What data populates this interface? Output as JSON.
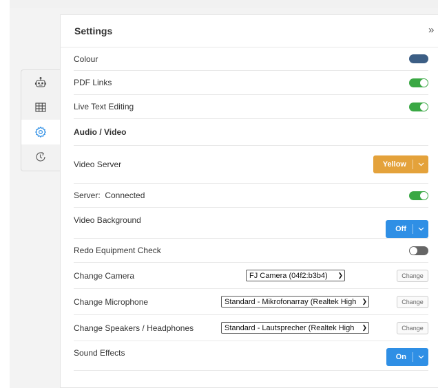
{
  "panel": {
    "title": "Settings",
    "collapse_label": "»"
  },
  "rail": {
    "items": [
      {
        "icon": "robot-icon",
        "active": false
      },
      {
        "icon": "grid-icon",
        "active": false
      },
      {
        "icon": "gear-icon",
        "active": true
      },
      {
        "icon": "history-icon",
        "active": false
      }
    ]
  },
  "rows": {
    "colour": {
      "label": "Colour",
      "toggle_on": true
    },
    "pdf_links": {
      "label": "PDF Links",
      "toggle_on": true
    },
    "live_text_editing": {
      "label": "Live Text Editing",
      "toggle_on": true
    },
    "audio_video": {
      "label": "Audio / Video"
    },
    "video_server": {
      "label": "Video Server",
      "value": "Yellow"
    },
    "server": {
      "label": "Server:  Connected",
      "toggle_on": true
    },
    "video_background": {
      "label": "Video Background",
      "value": "Off"
    },
    "redo_equipment_check": {
      "label": "Redo Equipment Check",
      "toggle_on": false
    },
    "change_camera": {
      "label": "Change Camera",
      "selected": "FJ Camera (04f2:b3b4)",
      "button": "Change"
    },
    "change_microphone": {
      "label": "Change Microphone",
      "selected": "Standard - Mikrofonarray (Realtek High",
      "button": "Change"
    },
    "change_speakers": {
      "label": "Change Speakers / Headphones",
      "selected": "Standard - Lautsprecher (Realtek High",
      "button": "Change"
    },
    "sound_effects": {
      "label": "Sound Effects",
      "value": "On"
    }
  },
  "colors": {
    "toggle_on": "#3aa844",
    "toggle_off": "#666666",
    "colour_swatch": "#3c5e85",
    "yellow_button": "#e4a23b",
    "blue_button": "#2f8fe5"
  }
}
